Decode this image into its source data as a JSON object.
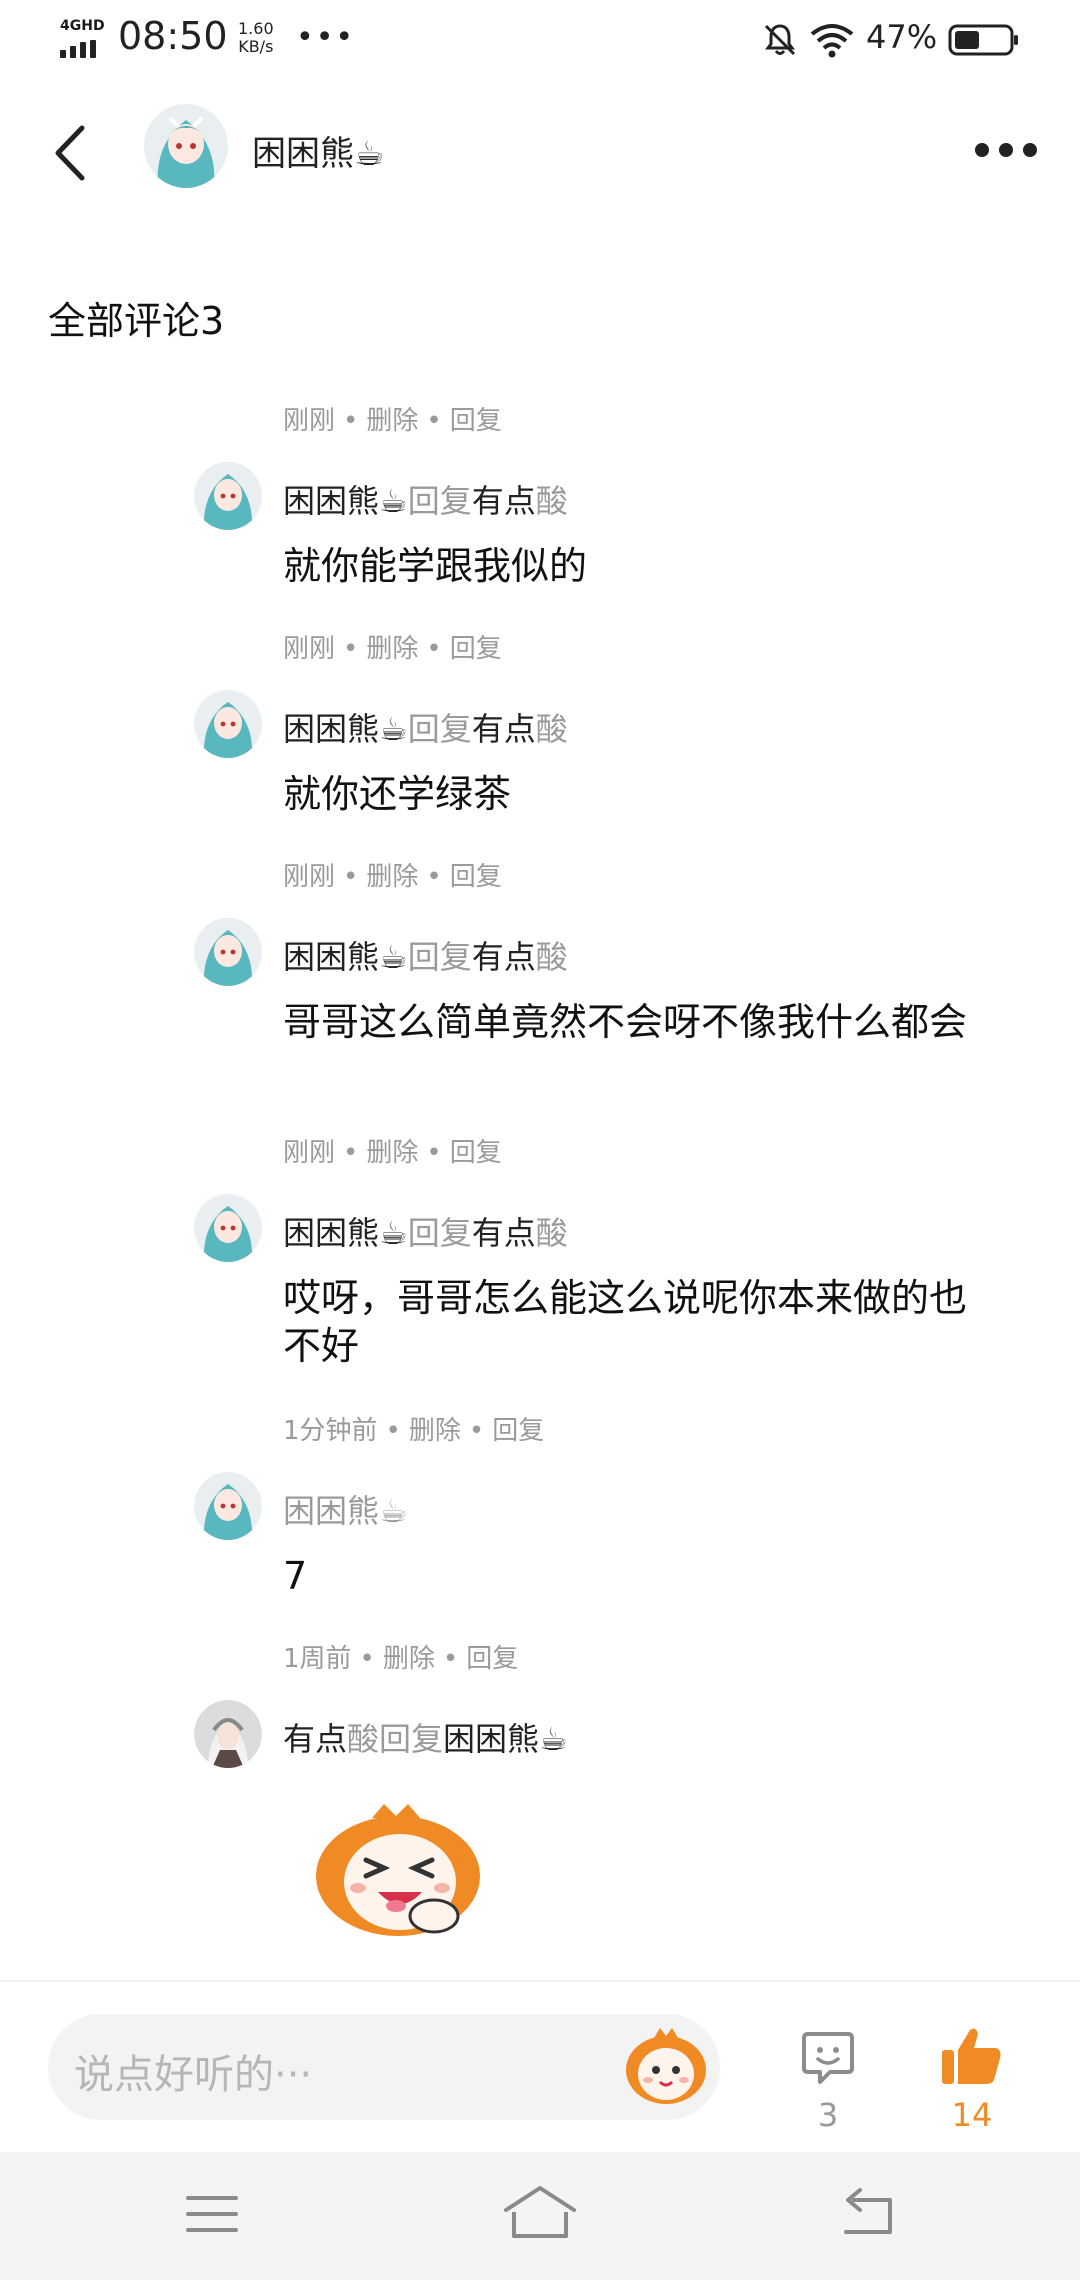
{
  "status_bar": {
    "network": "4GHD",
    "time": "08:50",
    "speed_value": "1.60",
    "speed_unit": "KB/s",
    "dots": "•••",
    "battery_percent": "47%",
    "battery_level": 0.47
  },
  "header": {
    "user_name": "困困熊☕",
    "back_icon": "chevron-left-icon",
    "more_icon": "more-horizontal-icon"
  },
  "section": {
    "title": "全部评论3"
  },
  "actions": {
    "delete": "删除",
    "reply": "回复",
    "separator": "•"
  },
  "comments": [
    {
      "time": "刚刚",
      "author": "困困熊☕",
      "reply_word": "回复",
      "target_main": "有点",
      "target_tail": "酸",
      "body": "就你能学跟我似的"
    },
    {
      "time": "刚刚",
      "author": "困困熊☕",
      "reply_word": "回复",
      "target_main": "有点",
      "target_tail": "酸",
      "body": "就你还学绿茶"
    },
    {
      "time": "刚刚",
      "author": "困困熊☕",
      "reply_word": "回复",
      "target_main": "有点",
      "target_tail": "酸",
      "body": "哥哥这么简单竟然不会呀不像我什么都会"
    },
    {
      "time": "刚刚",
      "author": "困困熊☕",
      "reply_word": "回复",
      "target_main": "有点",
      "target_tail": "酸",
      "body": "哎呀，哥哥怎么能这么说呢你本来做的也不好"
    },
    {
      "time": "1分钟前",
      "author": "困困熊☕",
      "body": "7"
    },
    {
      "time": "1周前",
      "author_main": "有点",
      "author_tail": "酸",
      "reply_word": "回复",
      "target": "困困熊☕",
      "sticker": "laughing-mascot-sticker"
    }
  ],
  "bottom_bar": {
    "input_placeholder": "说点好听的···",
    "comment_count": "3",
    "like_count": "14"
  },
  "colors": {
    "accent_orange": "#f08a24",
    "meta_gray": "#9a9a9a",
    "navbar_bg": "#f4f4f4"
  }
}
